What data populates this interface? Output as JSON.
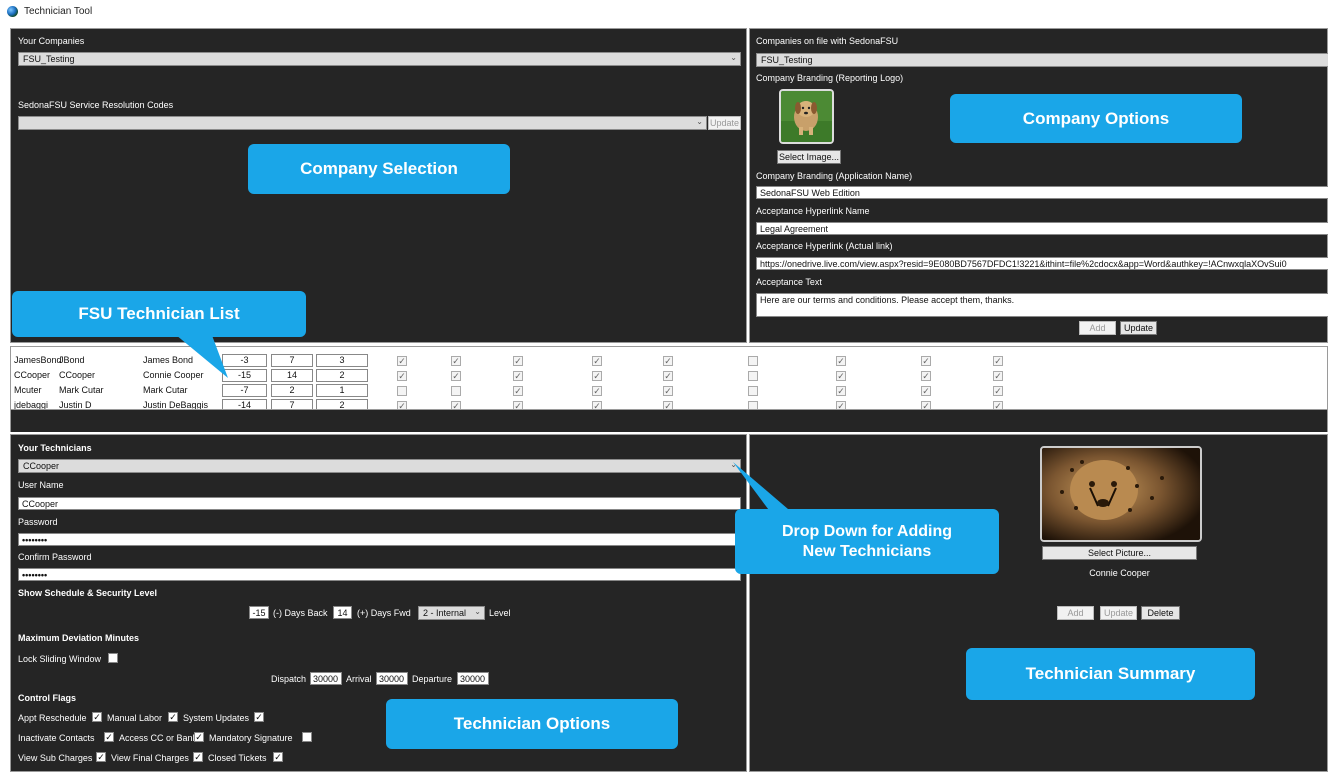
{
  "window": {
    "title": "Technician Tool"
  },
  "company_selection": {
    "your_companies_label": "Your Companies",
    "company_value": "FSU_Testing",
    "resolution_codes_label": "SedonaFSU Service Resolution Codes",
    "resolution_codes_value": "",
    "update_label": "Update",
    "callout": "Company Selection"
  },
  "company_options": {
    "on_file_label": "Companies on file with SedonaFSU",
    "on_file_value": "FSU_Testing",
    "branding_logo_label": "Company Branding (Reporting Logo)",
    "select_image_label": "Select Image...",
    "app_name_label": "Company Branding (Application Name)",
    "app_name_value": "SedonaFSU Web Edition",
    "hyperlink_name_label": "Acceptance Hyperlink Name",
    "hyperlink_name_value": "Legal Agreement",
    "hyperlink_link_label": "Acceptance Hyperlink (Actual link)",
    "hyperlink_link_value": "https://onedrive.live.com/view.aspx?resid=9E080BD7567DFDC1!3221&ithint=file%2cdocx&app=Word&authkey=!ACnwxqlaXOvSui0",
    "acceptance_text_label": "Acceptance Text",
    "acceptance_text_value": "Here are our terms and conditions. Please accept them, thanks.",
    "add_label": "Add",
    "update_label": "Update",
    "callout": "Company Options"
  },
  "technician_list": {
    "callout": "FSU Technician List",
    "rows": [
      {
        "id": "JamesBond",
        "user": "JBond",
        "name": "James Bond",
        "back": "-3",
        "fwd": "7",
        "level": "3",
        "flags": [
          true,
          true,
          true,
          true,
          true,
          false,
          true,
          true,
          true
        ],
        "greyed": [
          false,
          false,
          false,
          false,
          false,
          true,
          false,
          false,
          false
        ]
      },
      {
        "id": "CCooper",
        "user": "CCooper",
        "name": "Connie Cooper",
        "back": "-15",
        "fwd": "14",
        "level": "2",
        "flags": [
          true,
          true,
          true,
          true,
          true,
          false,
          true,
          true,
          true
        ],
        "greyed": [
          false,
          false,
          false,
          false,
          false,
          true,
          false,
          false,
          false
        ]
      },
      {
        "id": "Mcuter",
        "user": "Mark Cutar",
        "name": "Mark Cutar",
        "back": "-7",
        "fwd": "2",
        "level": "1",
        "flags": [
          false,
          false,
          true,
          true,
          true,
          false,
          true,
          true,
          true
        ],
        "greyed": [
          true,
          true,
          false,
          false,
          false,
          true,
          false,
          false,
          false
        ]
      },
      {
        "id": "jdebaggi",
        "user": "Justin D",
        "name": "Justin DeBaggis",
        "back": "-14",
        "fwd": "7",
        "level": "2",
        "flags": [
          true,
          true,
          true,
          true,
          true,
          false,
          true,
          true,
          true
        ],
        "greyed": [
          false,
          false,
          false,
          false,
          false,
          true,
          false,
          false,
          false
        ]
      }
    ]
  },
  "technician_options": {
    "your_technicians_label": "Your Technicians",
    "technician_value": "CCooper",
    "user_name_label": "User Name",
    "user_name_value": "CCooper",
    "password_label": "Password",
    "password_value": "••••••••",
    "confirm_password_label": "Confirm Password",
    "confirm_password_value": "••••••••",
    "schedule_label": "Show Schedule & Security Level",
    "days_back_value": "-15",
    "days_back_label": "(-) Days Back",
    "days_fwd_value": "14",
    "days_fwd_label": "(+) Days Fwd",
    "level_value": "2 - Internal",
    "level_label": "Level",
    "max_dev_label": "Maximum Deviation Minutes",
    "lock_sliding_label": "Lock Sliding Window",
    "dispatch_label": "Dispatch",
    "dispatch_value": "30000",
    "arrival_label": "Arrival",
    "arrival_value": "30000",
    "departure_label": "Departure",
    "departure_value": "30000",
    "control_flags_label": "Control Flags",
    "flags": {
      "appt_reschedule": "Appt Reschedule",
      "manual_labor": "Manual Labor",
      "system_updates": "System Updates",
      "inactivate_contacts": "Inactivate Contacts",
      "access_cc": "Access CC or Bank",
      "mandatory_signature": "Mandatory Signature",
      "view_sub_charges": "View Sub Charges",
      "view_final_charges": "View Final Charges",
      "closed_tickets": "Closed Tickets"
    },
    "callout": "Technician Options",
    "dropdown_callout_line1": "Drop Down for Adding",
    "dropdown_callout_line2": "New Technicians"
  },
  "technician_summary": {
    "select_picture_label": "Select Picture...",
    "technician_name": "Connie Cooper",
    "add_label": "Add",
    "update_label": "Update",
    "delete_label": "Delete",
    "callout": "Technician Summary"
  }
}
